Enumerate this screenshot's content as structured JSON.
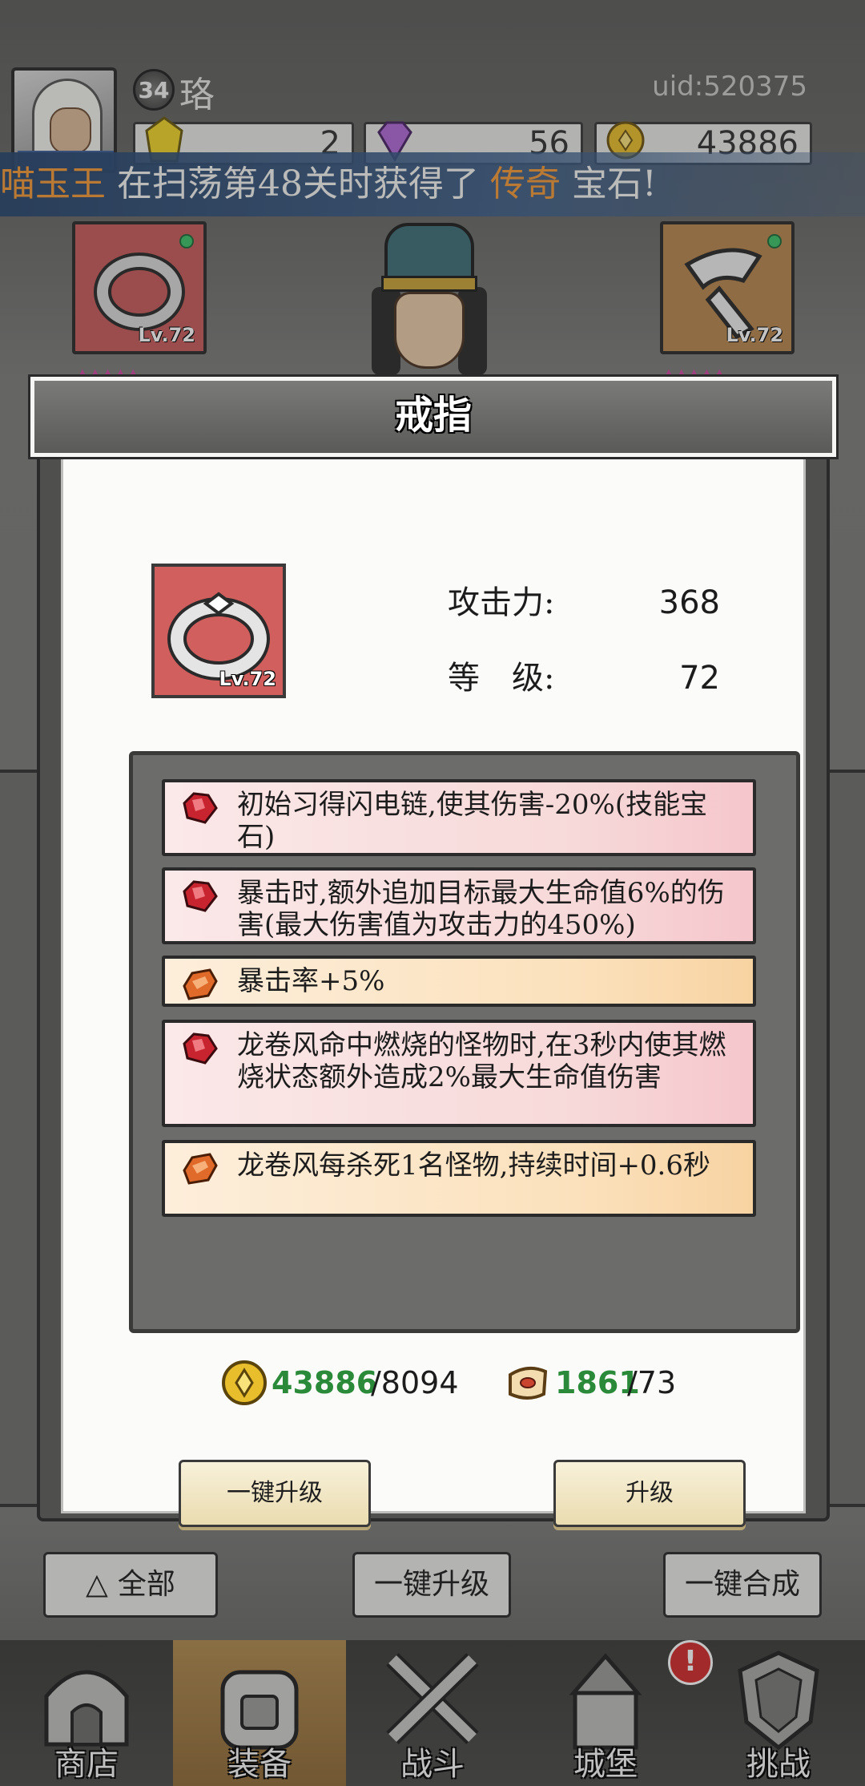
{
  "player": {
    "level": "34",
    "name": "珞",
    "uid": "uid:520375"
  },
  "currencies": [
    {
      "icon": "yellow-gem-icon",
      "value": "2"
    },
    {
      "icon": "purple-diamond-icon",
      "value": "56"
    },
    {
      "icon": "gold-coin-icon",
      "value": "43886"
    }
  ],
  "broadcast": {
    "player": "喵玉王",
    "middle": " 在扫荡第48关时获得了 ",
    "rarity": "传奇",
    "end": " 宝石!"
  },
  "equip_slots": {
    "left_level": "Lv.72",
    "right_level": "Lv.72"
  },
  "modal": {
    "title": "戒指",
    "item_level": "Lv.72",
    "stats": [
      {
        "label": "攻击力:",
        "value": "368"
      },
      {
        "label": "等　级:",
        "value": "72"
      }
    ],
    "gems": [
      {
        "color": "red",
        "text": "初始习得闪电链,使其伤害-20%(技能宝石)"
      },
      {
        "color": "red",
        "text": "暴击时,额外追加目标最大生命值6%的伤害(最大伤害值为攻击力的450%)"
      },
      {
        "color": "orange",
        "text": "暴击率+5%"
      },
      {
        "color": "red",
        "text": "龙卷风命中燃烧的怪物时,在3秒内使其燃烧状态额外造成2%最大生命值伤害"
      },
      {
        "color": "orange",
        "text": "龙卷风每杀死1名怪物,持续时间+0.6秒"
      }
    ],
    "cost_gold": {
      "have": "43886",
      "need": "/8094"
    },
    "cost_scroll": {
      "have": "1861",
      "need": "/73"
    },
    "btn_one_click_upgrade": "一键升级",
    "btn_upgrade": "升级"
  },
  "actions": {
    "all": "全部",
    "one_click_upgrade": "一键升级",
    "one_click_merge": "一键合成"
  },
  "nav": [
    {
      "label": "商店",
      "icon": "shop-icon"
    },
    {
      "label": "装备",
      "icon": "backpack-icon"
    },
    {
      "label": "战斗",
      "icon": "crossed-swords-icon"
    },
    {
      "label": "城堡",
      "icon": "castle-icon"
    },
    {
      "label": "挑战",
      "icon": "shield-icon"
    }
  ],
  "alert_badge": "!",
  "colors": {
    "have_green": "#2b8a3a",
    "broadcast_highlight": "#f39a3a",
    "red_gem": "#c8242f",
    "orange_gem": "#e06a2a"
  }
}
